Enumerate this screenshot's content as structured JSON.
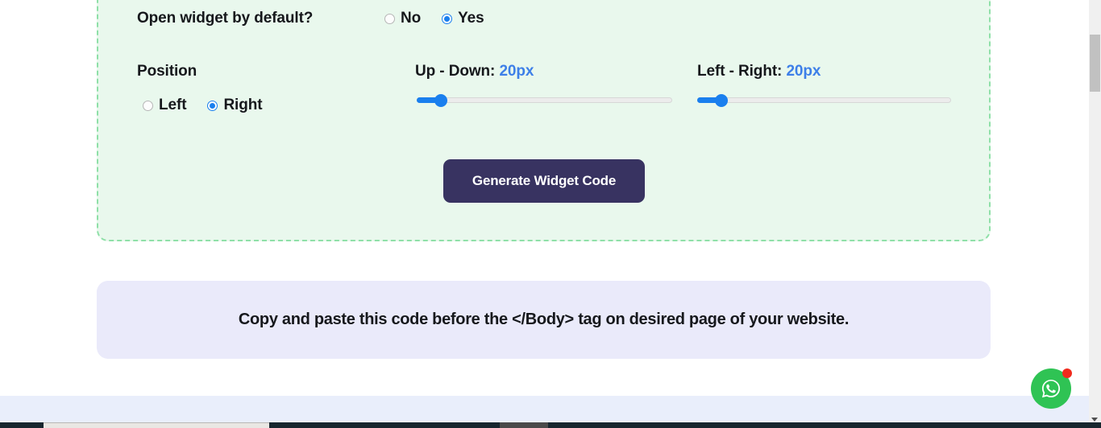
{
  "settings": {
    "open_widget": {
      "label": "Open widget by default?",
      "options": [
        {
          "label": "No",
          "selected": false
        },
        {
          "label": "Yes",
          "selected": true
        }
      ]
    },
    "position": {
      "label": "Position",
      "options": [
        {
          "label": "Left",
          "selected": false
        },
        {
          "label": "Right",
          "selected": true
        }
      ]
    },
    "up_down": {
      "label": "Up - Down:",
      "value": "20px",
      "percent": 7
    },
    "left_right": {
      "label": "Left - Right:",
      "value": "20px",
      "percent": 7
    },
    "generate_button": "Generate Widget Code"
  },
  "info_panel": {
    "text": "Copy and paste this code before the </Body> tag on desired page of your website."
  },
  "floating": {
    "whatsapp_icon": "whatsapp-icon",
    "badge": ""
  },
  "colors": {
    "panel_bg": "#e9f8ed",
    "panel_border": "#8fe0a8",
    "accent_blue": "#1a7fee",
    "button_bg": "#383361",
    "info_bg": "#eaeafa",
    "whatsapp_green": "#2fc354",
    "badge_red": "#f02b1d"
  }
}
